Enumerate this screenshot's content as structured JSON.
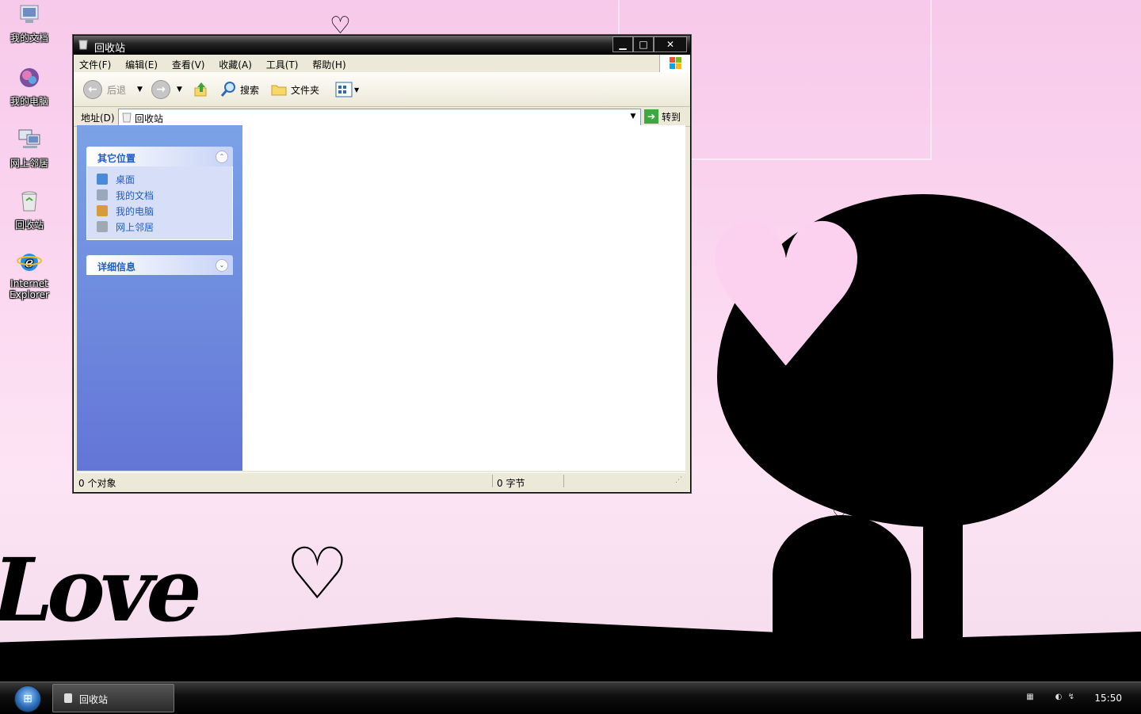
{
  "desktop": {
    "icons": [
      {
        "label": "我的文档",
        "icon": "my-documents-icon"
      },
      {
        "label": "我的电脑",
        "icon": "my-computer-icon"
      },
      {
        "label": "网上邻居",
        "icon": "network-places-icon"
      },
      {
        "label": "回收站",
        "icon": "recycle-bin-icon"
      },
      {
        "label": "Internet Explorer",
        "icon": "internet-explorer-icon"
      }
    ],
    "wallpaper_text": "Love"
  },
  "window": {
    "title": "回收站",
    "controls": {
      "minimize": "▁",
      "maximize": "□",
      "close": "✕"
    },
    "menu": [
      "文件(F)",
      "编辑(E)",
      "查看(V)",
      "收藏(A)",
      "工具(T)",
      "帮助(H)"
    ],
    "toolbar": {
      "back": "后退",
      "search": "搜索",
      "folders": "文件夹"
    },
    "address": {
      "label": "地址(D)",
      "value": "回收站",
      "go": "转到"
    },
    "taskpane": {
      "other_places": {
        "title": "其它位置",
        "links": [
          {
            "label": "桌面",
            "icon": "desktop-icon"
          },
          {
            "label": "我的文档",
            "icon": "my-documents-icon"
          },
          {
            "label": "我的电脑",
            "icon": "my-computer-icon"
          },
          {
            "label": "网上邻居",
            "icon": "network-places-icon"
          }
        ]
      },
      "details": {
        "title": "详细信息"
      }
    },
    "status": {
      "objects": "0 个对象",
      "size": "0 字节"
    }
  },
  "taskbar": {
    "task": "回收站",
    "clock": "15:50"
  },
  "colors": {
    "taskpane_top": "#7ba2e7",
    "taskpane_bottom": "#6375d6",
    "link_blue": "#215dc6",
    "wallpaper_pink": "#f7c9ea"
  }
}
